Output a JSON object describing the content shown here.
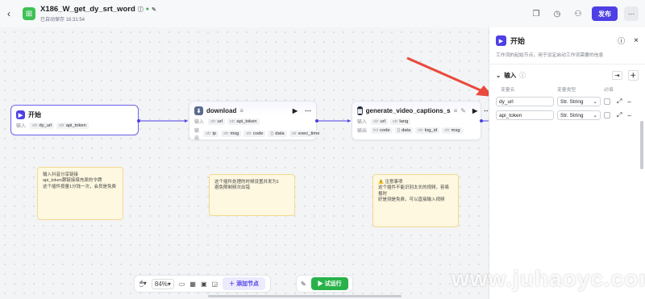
{
  "header": {
    "title": "X186_W_get_dy_srt_word",
    "subtitle": "已自动保存 16:31:54",
    "publish": "发布"
  },
  "nodes": {
    "start": {
      "title": "开始",
      "label_in": "输入",
      "params": [
        "dy_url",
        "api_token"
      ]
    },
    "download": {
      "title": "download",
      "label_in": "输入",
      "label_out": "输出",
      "in": [
        "url",
        "api_token"
      ],
      "out": [
        "ip",
        "msg",
        "code",
        "data",
        "exec_time"
      ]
    },
    "captions": {
      "title": "generate_video_captions_s",
      "label_in": "输入",
      "label_out": "输出",
      "in": [
        "url",
        "lang"
      ],
      "out": [
        "code",
        "data",
        "log_id",
        "msg"
      ]
    }
  },
  "notes": {
    "n1": [
      "输入抖音分享链接",
      "api_token跟链接填充原的令牌",
      "这个插件按量1分钱一次，会员是免费"
    ],
    "n2": [
      "这个插件处理的时候设置并发为1",
      "避免限制频次出错"
    ],
    "n3": [
      "⚠️ 注意事项",
      "这个插件不能识别太长的视频，容易报时",
      "好是测是免费，可以直接输入视频"
    ]
  },
  "bottom": {
    "zoom": "84%",
    "add_node": "添加节点",
    "run": "试运行"
  },
  "panel": {
    "title": "开始",
    "desc": "工作流的起始节点，用于设定启动工作流需要的信息",
    "section": "输入",
    "col_name": "变量名",
    "col_type": "变量类型",
    "col_req": "必填",
    "rows": [
      {
        "name": "dy_url",
        "type": "Str. String"
      },
      {
        "name": "api_token",
        "type": "Str. String"
      }
    ]
  },
  "watermark": "www.juhaoyc.com",
  "colors": {
    "accent": "#4e40e5",
    "run": "#29b24a",
    "note": "#fef8e1"
  }
}
